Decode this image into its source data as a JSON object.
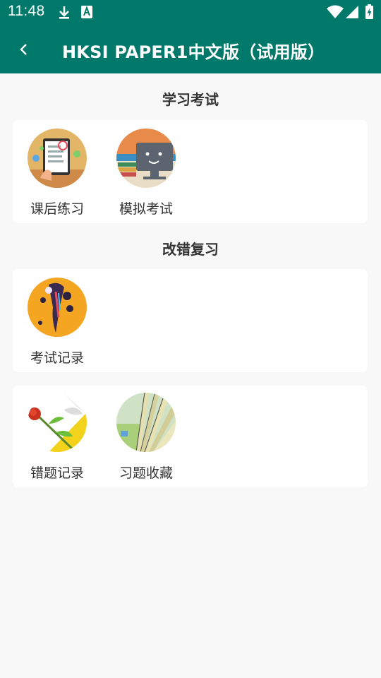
{
  "status_bar": {
    "time": "11:48"
  },
  "app_bar": {
    "title": "HKSI PAPER1中文版（试用版）"
  },
  "sections": {
    "study_exam": {
      "title": "学习考试",
      "items": [
        {
          "label": "课后练习",
          "icon": "tablet-quiz-icon"
        },
        {
          "label": "模拟考试",
          "icon": "monitor-face-icon"
        }
      ]
    },
    "review": {
      "title": "改错复习",
      "items": [
        {
          "label": "考试记录",
          "icon": "brush-paint-icon"
        }
      ]
    },
    "mistakes": {
      "items": [
        {
          "label": "错题记录",
          "icon": "rose-icon"
        },
        {
          "label": "习题收藏",
          "icon": "book-pages-icon"
        }
      ]
    }
  },
  "colors": {
    "primary": "#00796b",
    "background": "#f8f8f8",
    "card": "#ffffff"
  }
}
